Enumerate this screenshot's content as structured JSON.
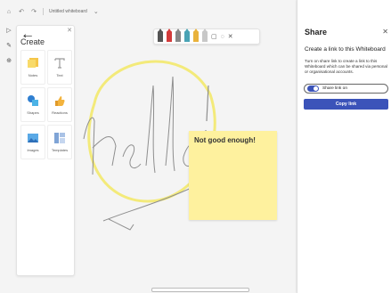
{
  "topbar": {
    "title": "Untitled whiteboard"
  },
  "create_panel": {
    "title": "Create",
    "tiles": [
      {
        "label": "Notes",
        "icon": "sticky-note-icon"
      },
      {
        "label": "Text",
        "icon": "text-icon"
      },
      {
        "label": "Shapes",
        "icon": "shapes-icon"
      },
      {
        "label": "Reactions",
        "icon": "thumbs-up-icon"
      },
      {
        "label": "Images",
        "icon": "image-icon"
      },
      {
        "label": "Templates",
        "icon": "templates-icon"
      }
    ]
  },
  "canvas": {
    "sticky_text": "Not good enough!",
    "sticky_color": "#fef19e",
    "ink_color": "#8e8e8e",
    "highlight_color": "#f3ea7a"
  },
  "ink_toolbar": {
    "pens": [
      "#555555",
      "#d33b3b",
      "#888888",
      "#4aa3b5",
      "#e9b23c",
      "#c8c8c8"
    ]
  },
  "share": {
    "title": "Share",
    "subtitle": "Create a link to this Whiteboard",
    "description": "Turn on share link to create a link to this Whiteboard which can be shared via personal or organisational accounts.",
    "toggle_label": "Share link on",
    "toggle_on": true,
    "copy_label": "Copy link",
    "accent": "#3b53b9"
  }
}
